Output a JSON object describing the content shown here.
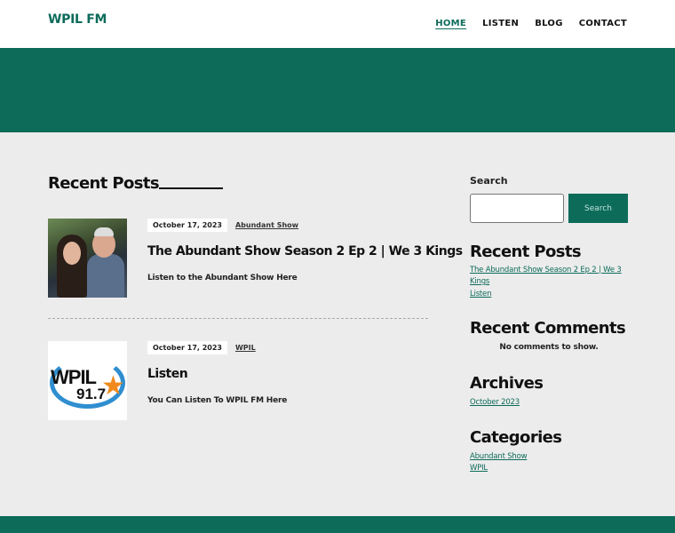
{
  "header": {
    "logo": "WPIL FM",
    "nav": [
      "HOME",
      "LISTEN",
      "BLOG",
      "CONTACT"
    ]
  },
  "main": {
    "section_title": "Recent Posts",
    "posts": [
      {
        "date": "October 17, 2023",
        "category": "Abundant Show",
        "title": "The Abundant Show Season 2 Ep 2 | We 3 Kings",
        "excerpt": "Listen to the Abundant Show Here"
      },
      {
        "date": "October 17, 2023",
        "category": "WPIL",
        "title": "Listen",
        "excerpt": "You Can Listen To WPIL FM Here",
        "thumb_text": "WPIL",
        "thumb_number": "91.7"
      }
    ]
  },
  "sidebar": {
    "search": {
      "label": "Search",
      "placeholder": "",
      "button": "Search"
    },
    "recent_posts": {
      "title": "Recent Posts",
      "items": [
        "The Abundant Show Season 2 Ep 2 | We 3 Kings",
        "Listen"
      ]
    },
    "recent_comments": {
      "title": "Recent Comments",
      "empty": "No comments to show."
    },
    "archives": {
      "title": "Archives",
      "items": [
        "October 2023"
      ]
    },
    "categories": {
      "title": "Categories",
      "items": [
        "Abundant Show",
        "WPIL"
      ]
    }
  },
  "colors": {
    "brand": "#0d6b5a",
    "background": "#ececec"
  }
}
